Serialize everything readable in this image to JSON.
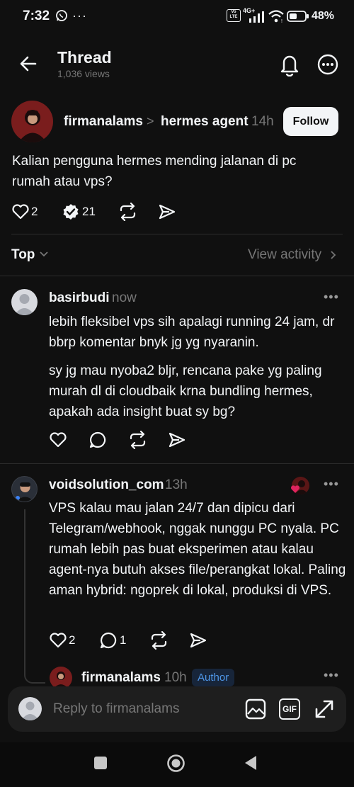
{
  "status_bar": {
    "time": "7:32",
    "battery": "48%",
    "icons": [
      "whatsapp-icon",
      "more-dots-icon",
      "volte-icon",
      "signal-4g-icon",
      "wifi-icon",
      "battery-icon"
    ],
    "network_badge": "4G+",
    "volte_badge": "Vo LTE"
  },
  "header": {
    "title": "Thread",
    "views": "1,036 views"
  },
  "post": {
    "author": "firmanalams",
    "separator": ">",
    "topic": "hermes agent",
    "time": "14h",
    "follow_label": "Follow",
    "body": "Kalian pengguna hermes mending jalanan di pc rumah atau vps?",
    "likes": "2",
    "replies": "21"
  },
  "sort": {
    "label": "Top",
    "view_activity": "View activity"
  },
  "comments": [
    {
      "author": "basirbudi",
      "time": "now",
      "paragraphs": [
        "lebih fleksibel vps sih apalagi running 24 jam, dr bbrp komentar bnyk jg yg nyaranin.",
        "sy jg mau nyoba2 bljr, rencana pake yg paling murah dl di cloudbaik krna bundling hermes, apakah ada insight buat sy bg?"
      ]
    },
    {
      "author": "voidsolution_com",
      "time": "13h",
      "text": "VPS kalau mau jalan 24/7 dan dipicu dari Telegram/webhook, nggak nunggu PC nyala. PC rumah lebih pas buat eksperimen atau kalau agent-nya butuh akses file/perangkat lokal. Paling aman hybrid: ngoprek di lokal, produksi di VPS.",
      "likes": "2",
      "replies": "1"
    },
    {
      "author": "firmanalams",
      "time": "10h",
      "badge": "Author"
    }
  ],
  "composer": {
    "placeholder": "Reply to firmanalams"
  },
  "colors": {
    "background": "#101010",
    "text": "#f3f5f7",
    "muted": "#777777",
    "author_badge": "#4f97e8",
    "like_heart": "#e0245e"
  }
}
